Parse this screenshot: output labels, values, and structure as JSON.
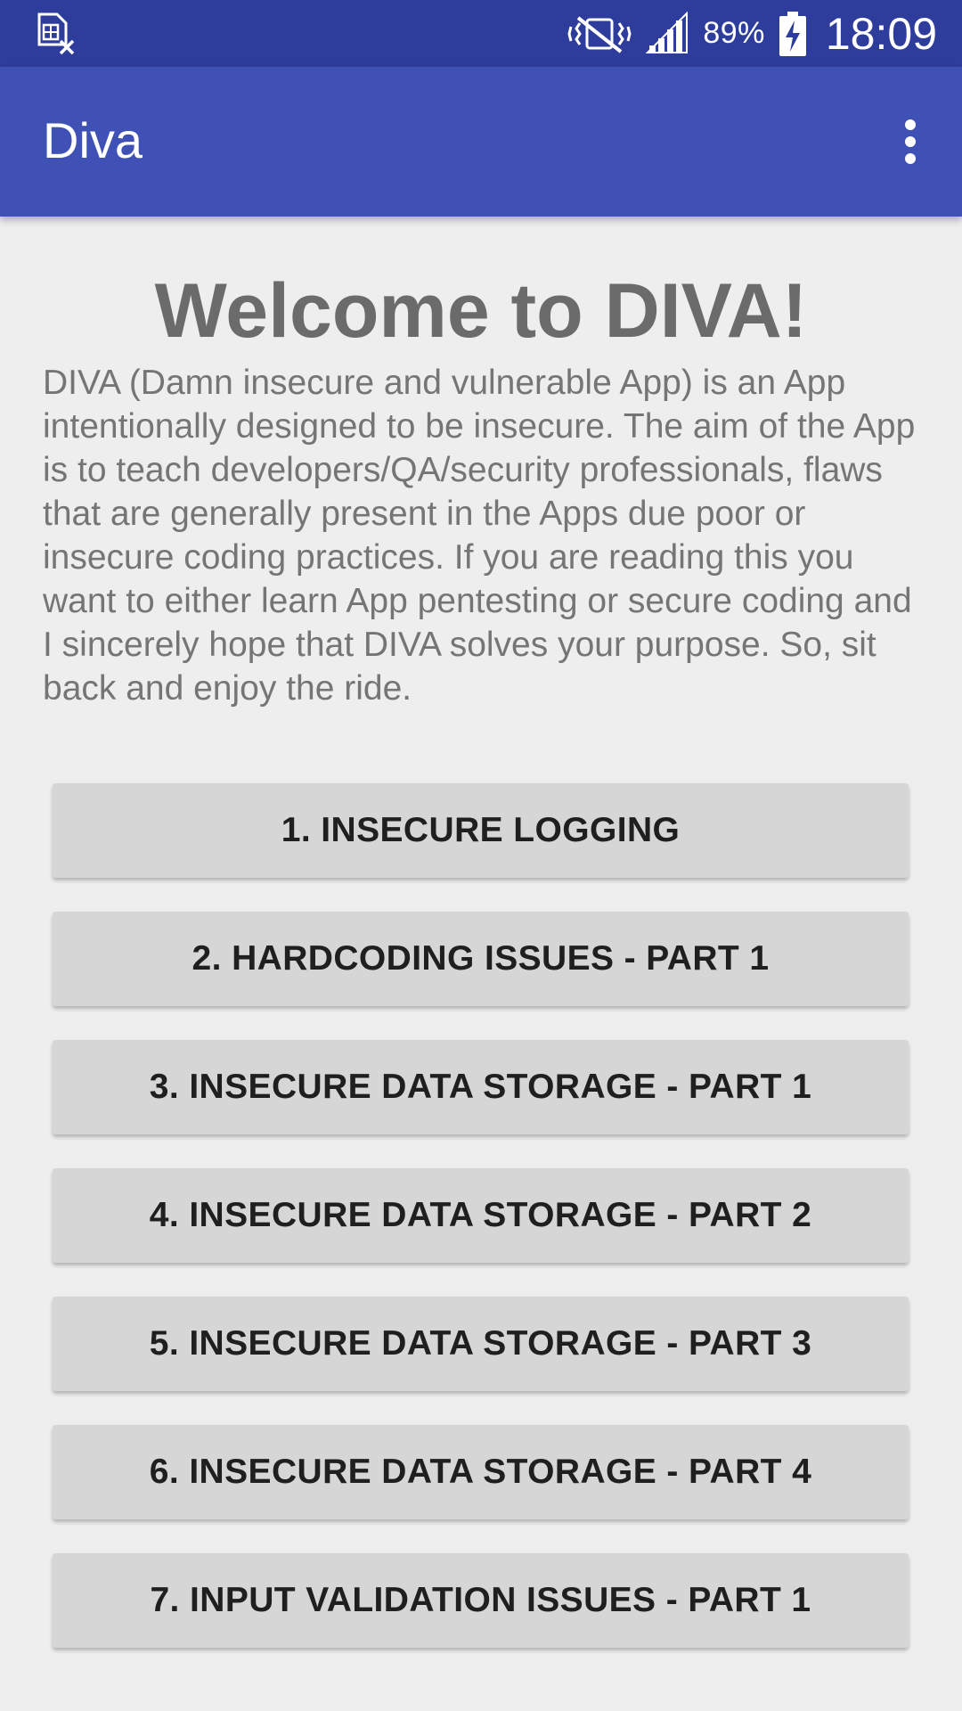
{
  "status_bar": {
    "notification_icon": "sim-card-blocked-icon",
    "vibrate_icon": "vibrate-mute-icon",
    "signal_icon": "cellular-signal-icon",
    "battery_icon": "battery-charging-icon",
    "battery_percent": "89%",
    "time": "18:09"
  },
  "app_bar": {
    "title": "Diva",
    "overflow_icon": "more-vert-icon"
  },
  "welcome": {
    "title": "Welcome to DIVA!",
    "description": "DIVA (Damn insecure and vulnerable App) is an App intentionally designed to be insecure. The aim of the App is to teach developers/QA/security professionals, flaws that are generally present in the Apps due poor or insecure coding practices. If you are reading this you want to either learn App pentesting or secure coding and I sincerely hope that DIVA solves your purpose. So, sit back and enjoy the ride."
  },
  "menu": [
    {
      "label": "1. INSECURE LOGGING"
    },
    {
      "label": "2. HARDCODING ISSUES - PART 1"
    },
    {
      "label": "3. INSECURE DATA STORAGE - PART 1"
    },
    {
      "label": "4. INSECURE DATA STORAGE - PART 2"
    },
    {
      "label": "5. INSECURE DATA STORAGE - PART 3"
    },
    {
      "label": "6. INSECURE DATA STORAGE - PART 4"
    },
    {
      "label": "7. INPUT VALIDATION ISSUES - PART 1"
    }
  ],
  "colors": {
    "status_bar": "#2e3d9c",
    "app_bar": "#3f51b5",
    "background": "#eeeeee",
    "button": "#d6d6d6"
  }
}
